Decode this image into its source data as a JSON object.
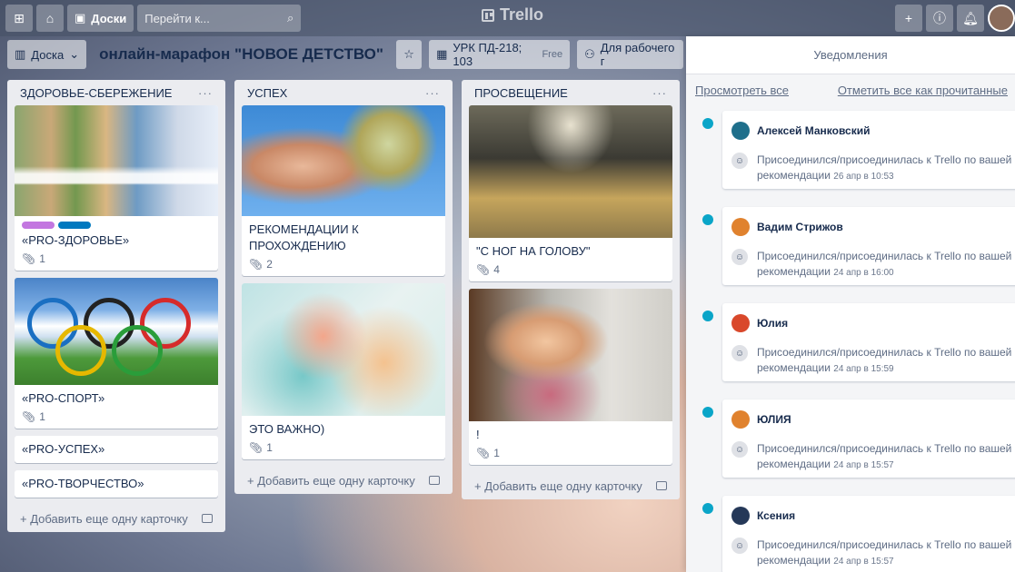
{
  "header": {
    "boards_label": "Доски",
    "search_placeholder": "Перейти к...",
    "logo_text": "Trello"
  },
  "board": {
    "view_label": "Доска",
    "title": "онлайн-марафон \"НОВОЕ ДЕТСТВО\"",
    "workspace_label": "УРК ПД-218; 103",
    "workspace_badge": "Free",
    "visibility_label": "Для рабочего г"
  },
  "lists": [
    {
      "title": "ЗДОРОВЬЕ-СБЕРЕЖЕНИЕ",
      "cards": [
        {
          "title": "«PRO-ЗДОРОВЬЕ»",
          "attachments": "1",
          "labels": [
            "#c377e0",
            "#0079bf"
          ]
        },
        {
          "title": "«PRO-СПОРТ»",
          "attachments": "1"
        },
        {
          "title": "«PRO-УСПЕХ»"
        },
        {
          "title": "«PRO-ТВОРЧЕСТВО»"
        }
      ],
      "add_label": "Добавить еще одну карточку"
    },
    {
      "title": "УСПЕХ",
      "cards": [
        {
          "title": "РЕКОМЕНДАЦИИ К ПРОХОЖДЕНИЮ",
          "attachments": "2"
        },
        {
          "title": "ЭТО ВАЖНО)",
          "attachments": "1"
        }
      ],
      "add_label": "Добавить еще одну карточку"
    },
    {
      "title": "ПРОСВЕЩЕНИЕ",
      "cards": [
        {
          "title": "\"С НОГ НА ГОЛОВУ\"",
          "attachments": "4"
        },
        {
          "title": "!",
          "attachments": "1"
        }
      ],
      "add_label": "Добавить еще одну карточку"
    }
  ],
  "notifications": {
    "title": "Уведомления",
    "view_all": "Просмотреть все",
    "mark_all": "Отметить все как прочитанные",
    "items": [
      {
        "user": "Алексей Манковский",
        "avatar_color": "#1f6f8b",
        "text": "Присоединился/присоединилась к Trello по вашей рекомендации",
        "time": "26 апр в 10:53"
      },
      {
        "user": "Вадим Стрижов",
        "avatar_color": "#e0822e",
        "text": "Присоединился/присоединилась к Trello по вашей рекомендации",
        "time": "24 апр в 16:00"
      },
      {
        "user": "Юлия",
        "avatar_color": "#d9482b",
        "text": "Присоединился/присоединилась к Trello по вашей рекомендации",
        "time": "24 апр в 15:59"
      },
      {
        "user": "ЮЛИЯ",
        "avatar_color": "#e0822e",
        "text": "Присоединился/присоединилась к Trello по вашей рекомендации",
        "time": "24 апр в 15:57"
      },
      {
        "user": "Ксения",
        "avatar_color": "#253858",
        "text": "Присоединился/присоединилась к Trello по вашей рекомендации",
        "time": "24 апр в 15:57"
      }
    ]
  }
}
